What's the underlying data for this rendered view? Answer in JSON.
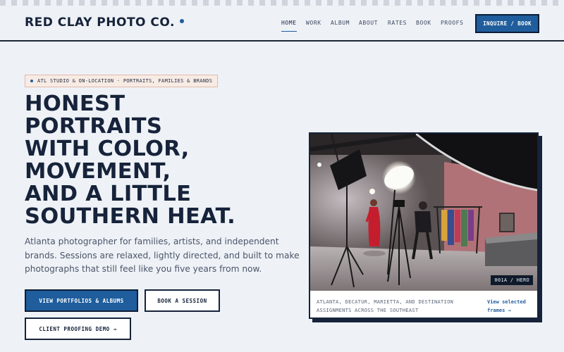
{
  "header": {
    "brand": "RED CLAY PHOTO CO.",
    "nav": [
      "HOME",
      "WORK",
      "ALBUM",
      "ABOUT",
      "RATES",
      "BOOK",
      "PROOFS"
    ],
    "active_nav": "HOME",
    "inquire": "INQUIRE / BOOK"
  },
  "hero": {
    "tag": "ATL STUDIO & ON-LOCATION · PORTRAITS, FAMILIES & BRANDS",
    "headline": [
      "HONEST",
      "PORTRAITS",
      "WITH COLOR,",
      "MOVEMENT,",
      "AND A LITTLE",
      "SOUTHERN HEAT."
    ],
    "intro": [
      "Atlanta photographer for families, artists, and independent",
      "brands. Sessions are relaxed, lightly directed, and built to make",
      "photographs that still feel like you five years from now."
    ],
    "buttons": {
      "portfolios": "VIEW PORTFOLIOS & ALBUMS",
      "book": "BOOK A SESSION",
      "proofing": "CLIENT PROOFING DEMO →"
    }
  },
  "card": {
    "photo_label": "001A / HERO",
    "caption": [
      "ATLANTA, DECATUR, MARIETTA, AND DESTINATION",
      "ASSIGNMENTS ACROSS THE SOUTHEAST"
    ],
    "link": [
      "View selected",
      "frames →"
    ]
  },
  "colors": {
    "accent": "#1f5d9c",
    "ink": "#16233a",
    "background": "#eef2f7",
    "tag_bg": "#f8ebe4"
  }
}
